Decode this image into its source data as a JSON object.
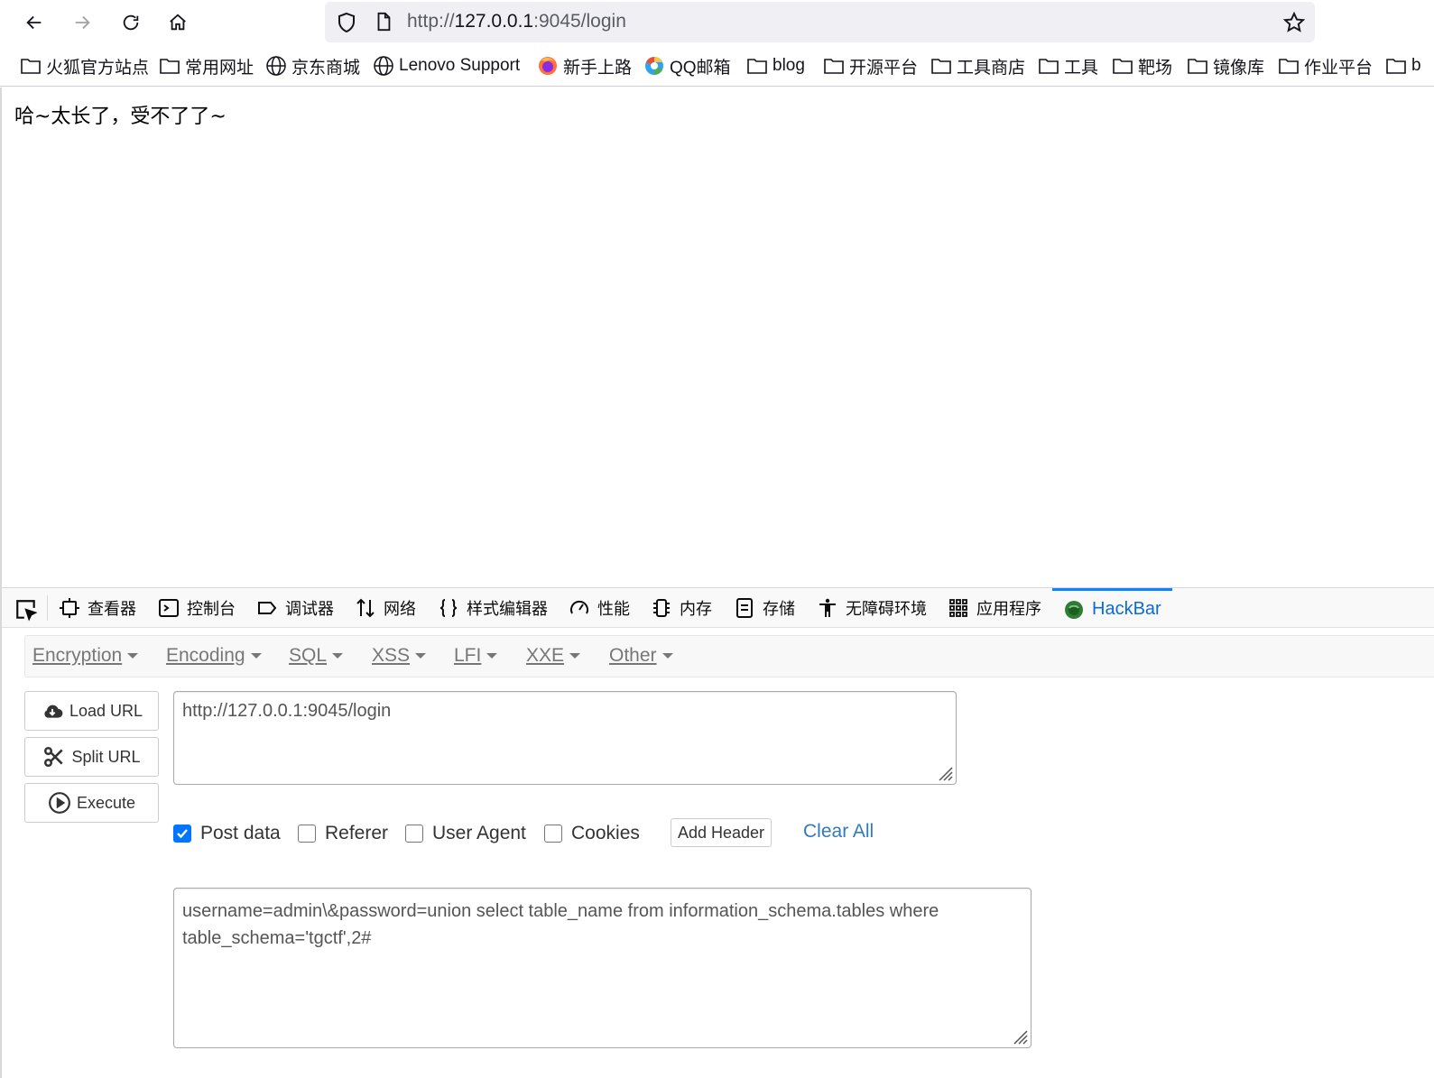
{
  "browser": {
    "address_bar": {
      "url_prefix": "http://",
      "url_host": "127.0.0.1",
      "url_suffix": ":9045/login"
    },
    "bookmarks": [
      {
        "label": "火狐官方站点",
        "icon": "folder-icon"
      },
      {
        "label": "常用网址",
        "icon": "folder-icon"
      },
      {
        "label": "京东商城",
        "icon": "globe-icon"
      },
      {
        "label": "Lenovo Support",
        "icon": "globe-icon"
      },
      {
        "label": "新手上路",
        "icon": "firefox-icon"
      },
      {
        "label": "QQ邮箱",
        "icon": "qq-mail-icon"
      },
      {
        "label": "blog",
        "icon": "folder-icon"
      },
      {
        "label": "开源平台",
        "icon": "folder-icon"
      },
      {
        "label": "工具商店",
        "icon": "folder-icon"
      },
      {
        "label": "工具",
        "icon": "folder-icon"
      },
      {
        "label": "靶场",
        "icon": "folder-icon"
      },
      {
        "label": "镜像库",
        "icon": "folder-icon"
      },
      {
        "label": "作业平台",
        "icon": "folder-icon"
      },
      {
        "label": "b",
        "icon": "folder-icon"
      }
    ]
  },
  "page": {
    "message": "哈~太长了，受不了了~"
  },
  "devtools": {
    "tabs": [
      {
        "label": "查看器",
        "icon": "inspector-icon"
      },
      {
        "label": "控制台",
        "icon": "console-icon"
      },
      {
        "label": "调试器",
        "icon": "debugger-icon"
      },
      {
        "label": "网络",
        "icon": "network-icon"
      },
      {
        "label": "样式编辑器",
        "icon": "style-editor-icon"
      },
      {
        "label": "性能",
        "icon": "performance-icon"
      },
      {
        "label": "内存",
        "icon": "memory-icon"
      },
      {
        "label": "存储",
        "icon": "storage-icon"
      },
      {
        "label": "无障碍环境",
        "icon": "accessibility-icon"
      },
      {
        "label": "应用程序",
        "icon": "application-icon"
      },
      {
        "label": "HackBar",
        "icon": "hackbar-icon",
        "selected": true
      }
    ],
    "accent_color": "#0a84ff"
  },
  "hackbar": {
    "menu": [
      "Encryption",
      "Encoding",
      "SQL",
      "XSS",
      "LFI",
      "XXE",
      "Other"
    ],
    "buttons": {
      "load_url": "Load URL",
      "split_url": "Split URL",
      "execute": "Execute"
    },
    "url_value": "http://127.0.0.1:9045/login",
    "options": {
      "post_data": {
        "label": "Post data",
        "checked": true
      },
      "referer": {
        "label": "Referer",
        "checked": false
      },
      "user_agent": {
        "label": "User Agent",
        "checked": false
      },
      "cookies": {
        "label": "Cookies",
        "checked": false
      }
    },
    "add_header_label": "Add Header",
    "clear_all_label": "Clear All",
    "post_body": "username=admin\\&password=union select table_name from information_schema.tables where table_schema='tgctf',2#"
  }
}
